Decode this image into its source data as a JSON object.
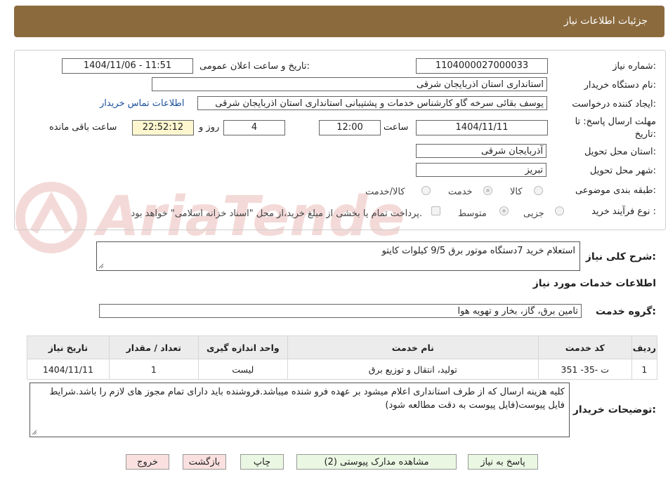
{
  "header": {
    "title": "جزئیات اطلاعات نیاز"
  },
  "form": {
    "need_number": {
      "label": "شماره نیاز:",
      "value": "1104000027000033"
    },
    "announce": {
      "label": "تاریخ و ساعت اعلان عمومی:",
      "value": "1404/11/06 - 11:51"
    },
    "buyer_org": {
      "label": "نام دستگاه خریدار:",
      "value": "استانداری استان اذربایجان شرقی"
    },
    "requester": {
      "label": "ایجاد کننده درخواست:",
      "value": "یوسف بقائی سرخه گاو کارشناس خدمات و پشتیبانی استانداری استان اذربایجان شرقی",
      "contact_link": "اطلاعات تماس خریدار"
    },
    "deadline": {
      "label": "مهلت ارسال پاسخ: تا تاریخ:",
      "date": "1404/11/11",
      "time_label": "ساعت",
      "time": "12:00",
      "days": "4",
      "days_label": "روز و",
      "remaining": "22:52:12",
      "remaining_label": "ساعت باقی مانده"
    },
    "province": {
      "label": "استان محل تحویل:",
      "value": "آذربایجان شرقی"
    },
    "city": {
      "label": "شهر محل تحویل:",
      "value": "تبریز"
    },
    "category": {
      "label": "طبقه بندی موضوعی:",
      "options": [
        "کالا",
        "خدمت",
        "کالا/خدمت"
      ],
      "selected": "خدمت"
    },
    "purchase_type": {
      "label": "نوع فرآیند خرید :",
      "options": [
        "جزیی",
        "متوسط"
      ],
      "selected": "متوسط",
      "payment_note": "پرداخت تمام یا بخشی از مبلغ خرید،از محل \"اسناد خزانه اسلامی\" خواهد بود."
    }
  },
  "summary": {
    "label": "شرح کلی نیاز:",
    "value": "استعلام خرید 7دستگاه موتور برق 9/5 کیلوات کایتو"
  },
  "services": {
    "title": "اطلاعات خدمات مورد نیاز",
    "group_label": "گروه خدمت:",
    "group_value": "تامین برق، گاز، بخار و تهویه هوا",
    "columns": [
      "ردیف",
      "کد خدمت",
      "نام خدمت",
      "واحد اندازه گیری",
      "تعداد / مقدار",
      "تاریخ نیاز"
    ],
    "rows": [
      [
        "1",
        "ت -35- 351",
        "تولید، انتقال و توزیع برق",
        "لیست",
        "1",
        "1404/11/11"
      ]
    ]
  },
  "buyer_notes": {
    "label": "توضیحات خریدار:",
    "value": "کلیه هزینه ارسال که از طرف استانداری اعلام میشود بر عهده فرو شنده میباشد.فروشنده باید دارای تمام مجوز های لازم را باشد.شرایط فایل پیوست(فایل پیوست به دقت مطالعه شود)"
  },
  "buttons": {
    "reply": "پاسخ به نیاز",
    "attachments": "مشاهده مدارک پیوستی (2)",
    "print": "چاپ",
    "back": "بازگشت",
    "exit": "خروج"
  },
  "watermark": {
    "text": "AriaTender.neT",
    "color": "#c0392b"
  }
}
